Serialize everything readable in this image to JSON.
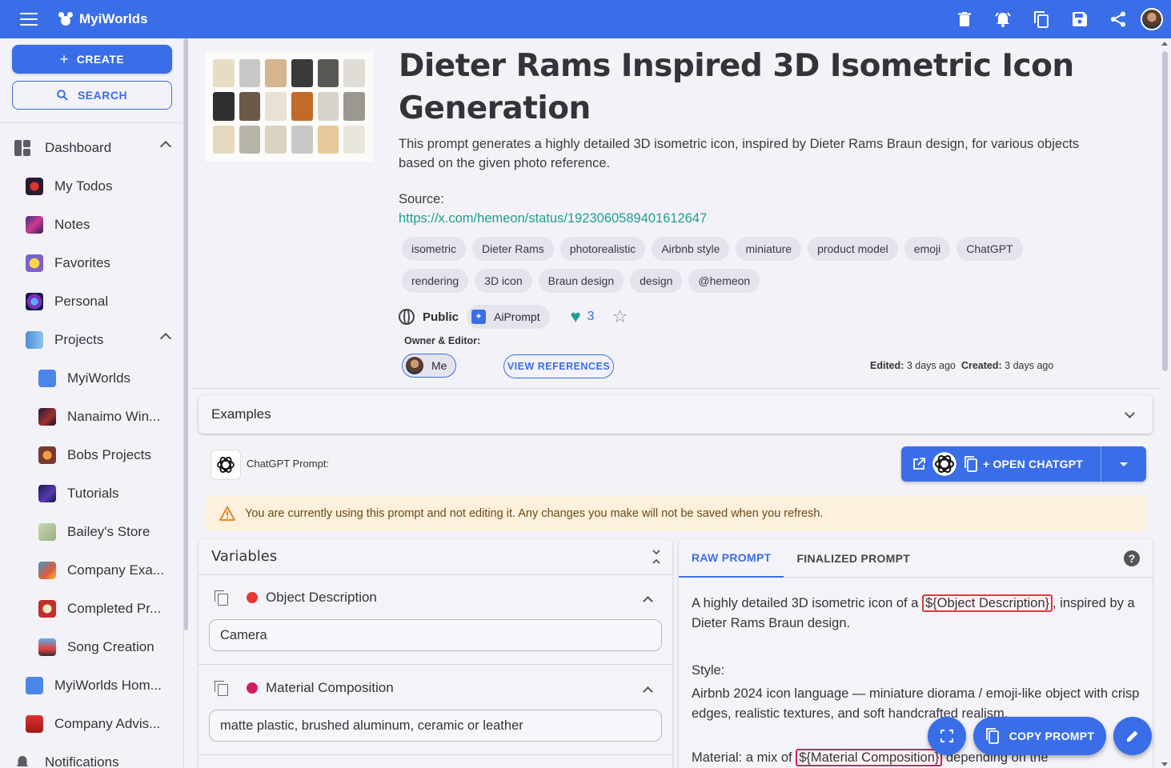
{
  "app": {
    "name": "MyiWorlds"
  },
  "topbar": {
    "icons": [
      "trash-icon",
      "alarm-icon",
      "duplicate-icon",
      "save-icon",
      "share-icon",
      "avatar"
    ]
  },
  "sidebar": {
    "create_label": "CREATE",
    "search_label": "SEARCH",
    "items": [
      {
        "label": "Dashboard",
        "level": 0,
        "icon": "dashboard-icon",
        "expanded": true
      },
      {
        "label": "My Todos",
        "level": 1
      },
      {
        "label": "Notes",
        "level": 1
      },
      {
        "label": "Favorites",
        "level": 1
      },
      {
        "label": "Personal",
        "level": 1
      },
      {
        "label": "Projects",
        "level": 1,
        "expanded": true
      },
      {
        "label": "MyiWorlds",
        "level": 2
      },
      {
        "label": "Nanaimo Win...",
        "level": 2
      },
      {
        "label": "Bobs Projects",
        "level": 2
      },
      {
        "label": "Tutorials",
        "level": 2
      },
      {
        "label": "Bailey's Store",
        "level": 2
      },
      {
        "label": "Company Exa...",
        "level": 2
      },
      {
        "label": "Completed Pr...",
        "level": 2
      },
      {
        "label": "Song Creation",
        "level": 2
      },
      {
        "label": "MyiWorlds Hom...",
        "level": 1
      },
      {
        "label": "Company Advis...",
        "level": 1
      },
      {
        "label": "Notifications",
        "level": 0
      }
    ]
  },
  "main": {
    "title": "Dieter Rams Inspired 3D Isometric Icon Generation",
    "description": "This prompt generates a highly detailed 3D isometric icon, inspired by Dieter Rams Braun design, for various objects based on the given photo reference.",
    "source_label": "Source:",
    "source_url": "https://x.com/hemeon/status/1923060589401612647",
    "tags": [
      "isometric",
      "Dieter Rams",
      "photorealistic",
      "Airbnb style",
      "miniature",
      "product model",
      "emoji",
      "ChatGPT",
      "rendering",
      "3D icon",
      "Braun design",
      "design",
      "@hemeon"
    ],
    "visibility": "Public",
    "type_chip": "AiPrompt",
    "likes": "3",
    "owner_label": "Owner & Editor:",
    "owner_name": "Me",
    "view_references": "VIEW REFERENCES",
    "edited_label": "Edited:",
    "edited_value": "3 days ago",
    "created_label": "Created:",
    "created_value": "3 days ago"
  },
  "examples": {
    "label": "Examples"
  },
  "chatgpt": {
    "prompt_label": "ChatGPT Prompt:",
    "open_label": "+ OPEN CHATGPT"
  },
  "warning": "You are currently using this prompt and not editing it. Any changes you make will not be saved when you refresh.",
  "variables": {
    "title": "Variables",
    "items": [
      {
        "name": "Object Description",
        "value": "Camera",
        "color": "#e53935"
      },
      {
        "name": "Material Composition",
        "value": "matte plastic, brushed aluminum, ceramic or leather",
        "color": "#d81b60"
      }
    ]
  },
  "prompt": {
    "tabs": [
      "RAW PROMPT",
      "FINALIZED PROMPT"
    ],
    "line1_pre": "A highly detailed 3D isometric icon of a ",
    "line1_var": "${Object Description}",
    "line1_post": ", inspired by a Dieter Rams Braun design.",
    "style_label": "Style:",
    "style_text": "Airbnb 2024 icon language — miniature diorama / emoji-like object with crisp edges, realistic textures, and soft handcrafted realism.",
    "material_pre": "Material: a mix of ",
    "material_var": "${Material Composition}",
    "material_post": " depending on the"
  },
  "fabs": {
    "copy_label": "COPY PROMPT"
  },
  "colors": {
    "primary": "#3a6ee8",
    "accent": "#1e9e8e",
    "warning_bg": "#fdf0dc"
  }
}
